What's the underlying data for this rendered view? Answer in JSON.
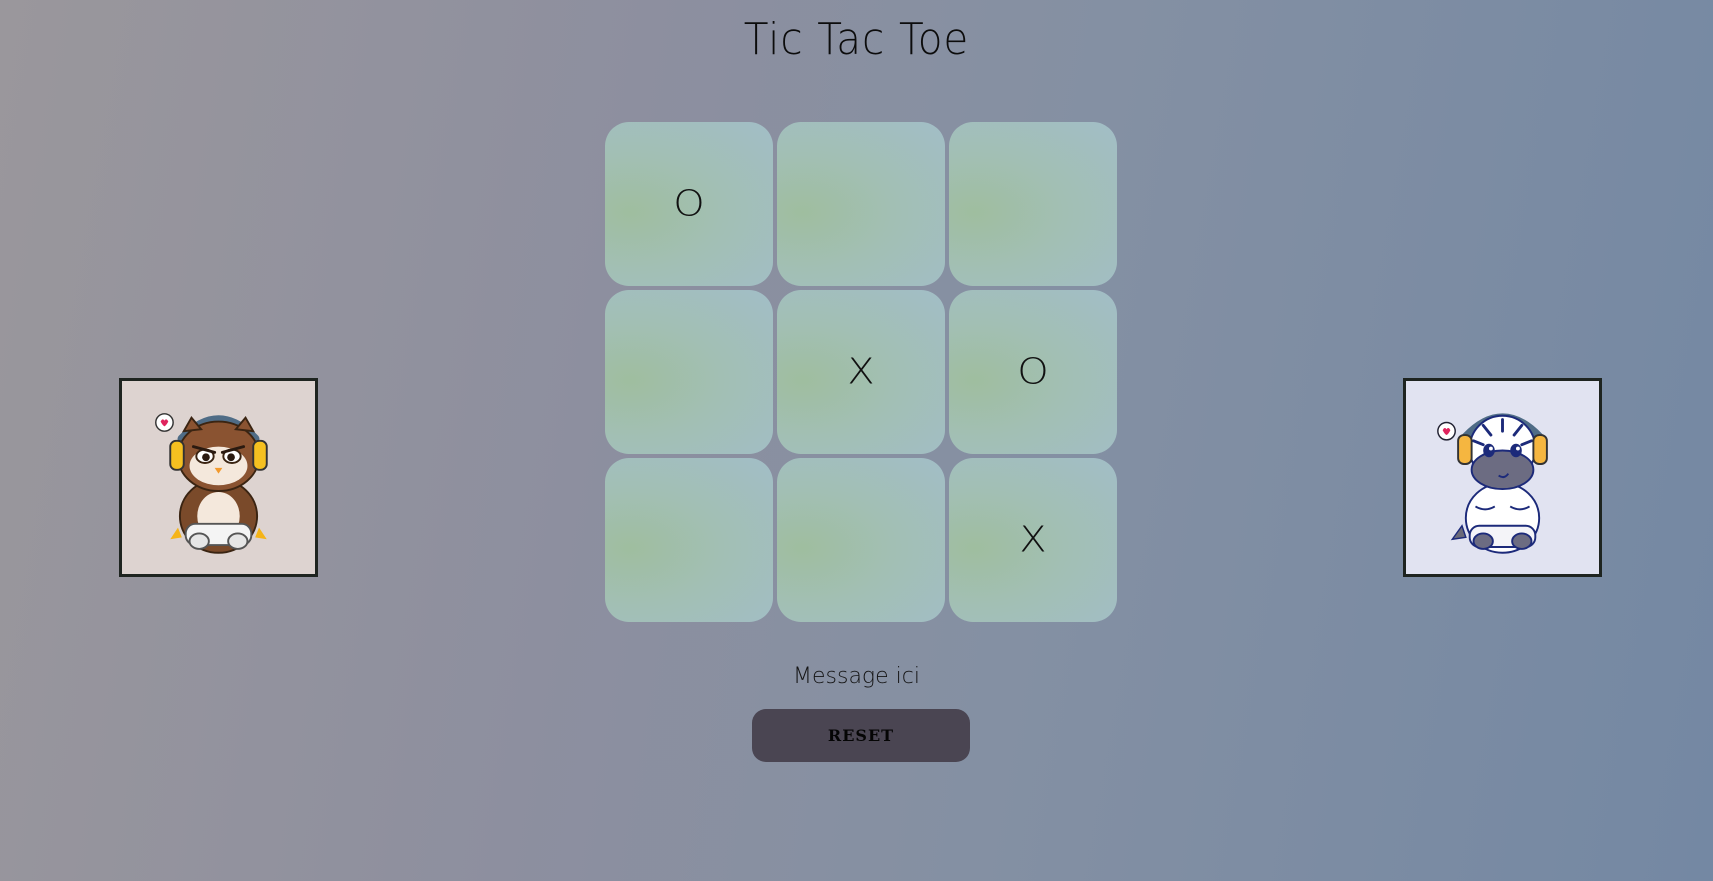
{
  "game": {
    "title": "Tic Tac Toe",
    "board": [
      "O",
      "",
      "",
      "",
      "X",
      "O",
      "",
      "",
      "X"
    ],
    "message": "Message ici",
    "reset_label": "RESET"
  },
  "players": {
    "left": {
      "avatar": "owl-gamer-avatar"
    },
    "right": {
      "avatar": "zebra-gamer-avatar"
    }
  },
  "colors": {
    "cell": "#a2bfb4",
    "button": "#4a4552"
  }
}
